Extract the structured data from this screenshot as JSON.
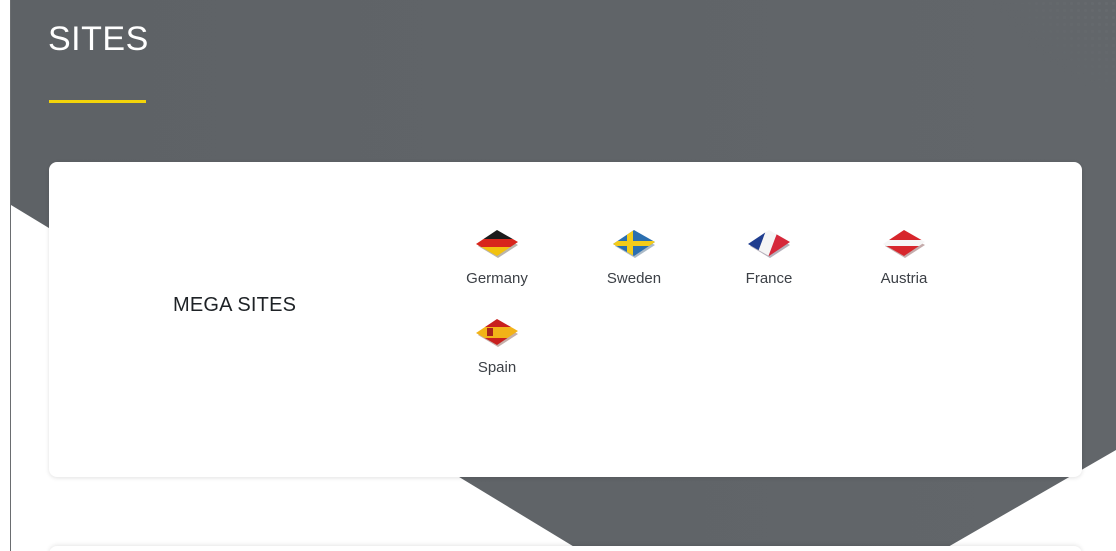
{
  "section": {
    "title": "SITES",
    "accent_color": "#f3d40a"
  },
  "mega_sites": {
    "label": "MEGA SITES",
    "sites": [
      {
        "name": "Germany",
        "flag": "germany-flag-icon"
      },
      {
        "name": "Sweden",
        "flag": "sweden-flag-icon"
      },
      {
        "name": "France",
        "flag": "france-flag-icon"
      },
      {
        "name": "Austria",
        "flag": "austria-flag-icon"
      },
      {
        "name": "Spain",
        "flag": "spain-flag-icon"
      }
    ]
  }
}
